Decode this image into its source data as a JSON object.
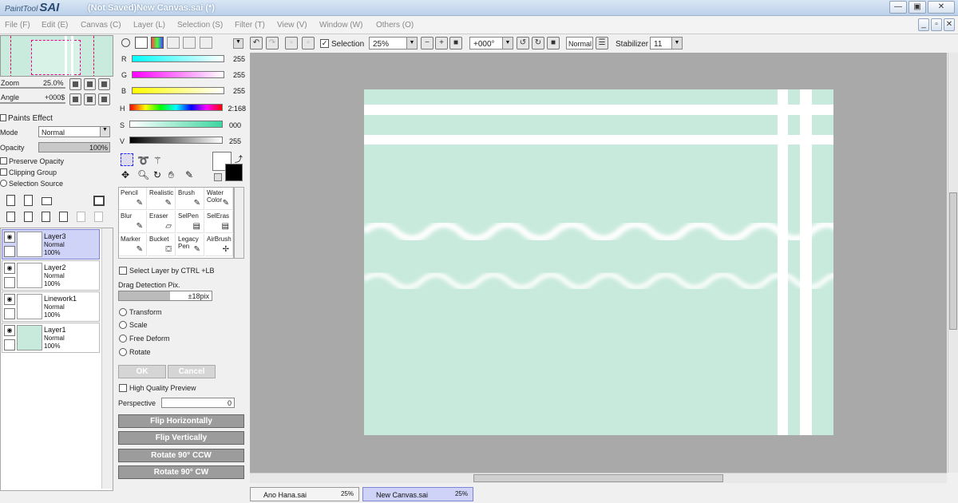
{
  "titlebar": {
    "logo_small": "PaintTool",
    "logo_big": "SAI",
    "title": "(Not Saved)New Canvas.sai (*)",
    "minimize": "—",
    "maximize": "▣",
    "close": "✕"
  },
  "menu": [
    "File (F)",
    "Edit (E)",
    "Canvas (C)",
    "Layer (L)",
    "Selection (S)",
    "Filter (T)",
    "View (V)",
    "Window (W)",
    "Others (O)"
  ],
  "navigator": {
    "zoom_label": "Zoom",
    "zoom_value": "25.0%",
    "angle_label": "Angle",
    "angle_value": "+000$"
  },
  "layer_props": {
    "paints_effect": "Paints Effect",
    "mode_label": "Mode",
    "mode_value": "Normal",
    "opacity_label": "Opacity",
    "opacity_value": "100%",
    "preserve_opacity": "Preserve Opacity",
    "clipping_group": "Clipping Group",
    "selection_source": "Selection Source"
  },
  "layers": [
    {
      "name": "Layer3",
      "mode": "Normal",
      "opacity": "100%",
      "selected": true
    },
    {
      "name": "Layer2",
      "mode": "Normal",
      "opacity": "100%",
      "selected": false
    },
    {
      "name": "Linework1",
      "mode": "Normal",
      "opacity": "100%",
      "selected": false
    },
    {
      "name": "Layer1",
      "mode": "Normal",
      "opacity": "100%",
      "selected": false
    }
  ],
  "color_sliders": {
    "r_label": "R",
    "r_value": "255",
    "g_label": "G",
    "g_value": "255",
    "b_label": "B",
    "b_value": "255",
    "h_label": "H",
    "h_value": "2:168",
    "s_label": "S",
    "s_value": "000",
    "v_label": "V",
    "v_value": "255"
  },
  "tools": [
    {
      "name": "Pencil"
    },
    {
      "name": "Realistic"
    },
    {
      "name": "Brush"
    },
    {
      "name": "Water Color"
    },
    {
      "name": "Blur"
    },
    {
      "name": "Eraser"
    },
    {
      "name": "SelPen"
    },
    {
      "name": "SelEras"
    },
    {
      "name": "Marker"
    },
    {
      "name": "Bucket"
    },
    {
      "name": "Legacy Pen"
    },
    {
      "name": "AirBrush"
    }
  ],
  "transform": {
    "select_layer": "Select Layer by CTRL +LB",
    "drag_detection": "Drag Detection Pix.",
    "drag_value": "±18pix",
    "options": [
      "Transform",
      "Scale",
      "Free Deform",
      "Rotate"
    ],
    "ok": "OK",
    "cancel": "Cancel",
    "hq_preview": "High Quality Preview",
    "perspective_label": "Perspective",
    "perspective_value": "0",
    "flip_h": "Flip Horizontally",
    "flip_v": "Flip Vertically",
    "rotate_ccw": "Rotate 90° CCW",
    "rotate_cw": "Rotate 90° CW"
  },
  "toolbar": {
    "selection_label": "Selection",
    "zoom_value": "25%",
    "angle_value": "+000°",
    "blend_mode": "Normal",
    "stabilizer_label": "Stabilizer",
    "stabilizer_value": "11"
  },
  "tabs": [
    {
      "name": "Ano Hana.sai",
      "zoom": "25%"
    },
    {
      "name": "New Canvas.sai",
      "zoom": "25%"
    }
  ],
  "colors": {
    "canvas_fill": "#c8eadc",
    "workspace": "#a9a9a9",
    "selected_layer": "#cfd3f7"
  }
}
